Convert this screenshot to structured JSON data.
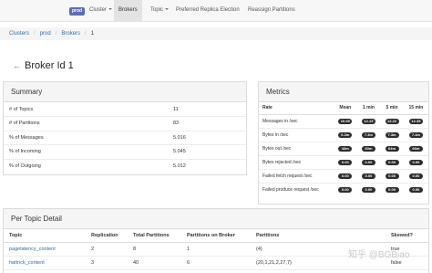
{
  "nav": {
    "badge": "prod",
    "items": [
      {
        "label": "Cluster",
        "dropdown": true
      },
      {
        "label": "Brokers",
        "active": true
      },
      {
        "label": "Topic",
        "dropdown": true
      },
      {
        "label": "Preferred Replica Election"
      },
      {
        "label": "Reassign Partitions"
      }
    ]
  },
  "breadcrumb": [
    "Clusters",
    "prod",
    "Brokers",
    "1"
  ],
  "page": {
    "title": "Broker Id 1",
    "back_icon": "arrow-left-icon"
  },
  "summary": {
    "title": "Summary",
    "rows": [
      {
        "label": "# of Topics",
        "value": "11"
      },
      {
        "label": "# of Partitions",
        "value": "83"
      },
      {
        "label": "% of Messages",
        "value": "5.016"
      },
      {
        "label": "% of Incoming",
        "value": "5.045"
      },
      {
        "label": "% of Outgoing",
        "value": "5.012"
      }
    ]
  },
  "metrics": {
    "title": "Metrics",
    "headers": [
      "Rate",
      "Mean",
      "1 min",
      "5 min",
      "15 min"
    ],
    "rows": [
      {
        "label": "Messages in /sec",
        "values": [
          "10.09",
          "12.13",
          "12.22",
          "12.35"
        ]
      },
      {
        "label": "Bytes in /sec",
        "values": [
          "6.2m",
          "7.3m",
          "7.3m",
          "7.4m"
        ]
      },
      {
        "label": "Bytes out /sec",
        "values": [
          "43m",
          "60m",
          "64m",
          "66m"
        ]
      },
      {
        "label": "Bytes rejected /sec",
        "values": [
          "0.00",
          "0.00",
          "0.00",
          "0.00"
        ]
      },
      {
        "label": "Failed fetch request /sec",
        "values": [
          "0.00",
          "0.00",
          "0.00",
          "0.00"
        ]
      },
      {
        "label": "Failed produce request /sec",
        "values": [
          "0.00",
          "0.00",
          "0.00",
          "0.00"
        ]
      }
    ]
  },
  "topics": {
    "title": "Per Topic Detail",
    "headers": [
      "Topic",
      "Replication",
      "Total Partitions",
      "Partitions on Broker",
      "Partitions",
      "Skewed?"
    ],
    "rows": [
      {
        "topic": "pagelatency_content",
        "replication": "2",
        "total": "8",
        "on_broker": "1",
        "partitions": "(4)",
        "skewed": "true"
      },
      {
        "topic": "hattrick_content",
        "replication": "3",
        "total": "40",
        "on_broker": "6",
        "partitions": "(20,1,21,2,27,7)",
        "skewed": "false"
      }
    ]
  },
  "watermark": "知乎 @BGBiao"
}
